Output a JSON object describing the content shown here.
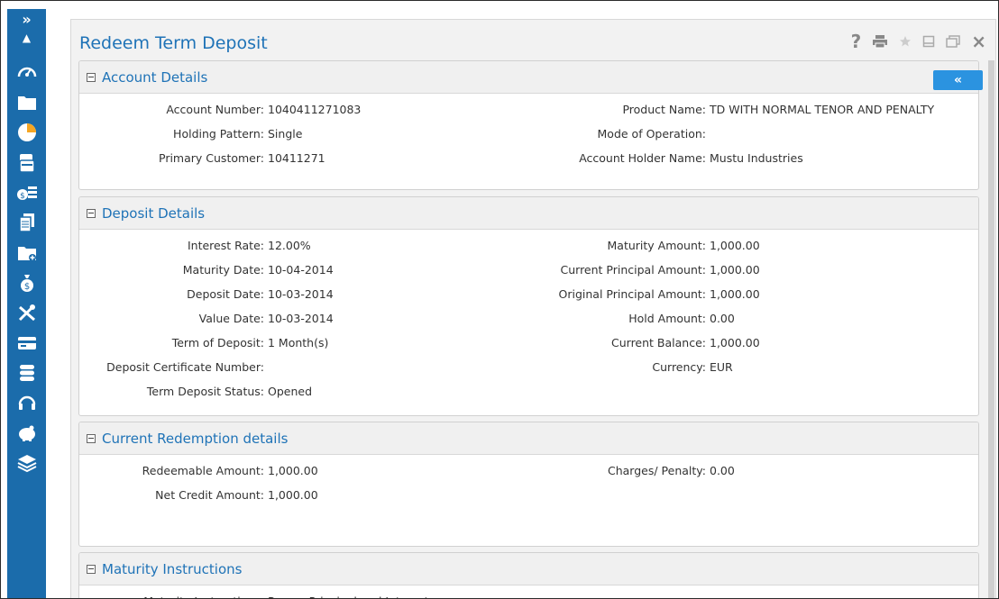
{
  "window": {
    "title": "Redeem Term Deposit",
    "collapse_label": "«"
  },
  "rail": {
    "expand_label": "»",
    "up_label": "▲",
    "icons": [
      "dashboard-icon",
      "folder-icon",
      "pie-chart-icon",
      "cards-icon",
      "money-icon",
      "documents-icon",
      "folder-add-icon",
      "money-bag-icon",
      "tools-icon",
      "credit-card-icon",
      "database-icon",
      "headset-icon",
      "piggy-bank-icon",
      "layers-icon"
    ]
  },
  "toolbar": {
    "help": "?",
    "print": "print-icon",
    "favorite": "star-icon",
    "minimize": "minimize-icon",
    "restore": "restore-icon",
    "close": "×"
  },
  "account": {
    "title": "Account Details",
    "left": [
      {
        "label": "Account Number:",
        "value": "1040411271083"
      },
      {
        "label": "Holding Pattern:",
        "value": "Single"
      },
      {
        "label": "Primary Customer:",
        "value": "10411271"
      }
    ],
    "right": [
      {
        "label": "Product Name:",
        "value": "TD WITH NORMAL TENOR AND PENALTY"
      },
      {
        "label": "Mode of Operation:",
        "value": ""
      },
      {
        "label": "Account Holder Name:",
        "value": "Mustu Industries"
      }
    ]
  },
  "deposit": {
    "title": "Deposit Details",
    "left": [
      {
        "label": "Interest Rate:",
        "value": "12.00%"
      },
      {
        "label": "Maturity Date:",
        "value": "10-04-2014"
      },
      {
        "label": "Deposit Date:",
        "value": "10-03-2014"
      },
      {
        "label": "Value Date:",
        "value": "10-03-2014"
      },
      {
        "label": "Term of Deposit:",
        "value": "1 Month(s)"
      },
      {
        "label": "Deposit Certificate Number:",
        "value": ""
      },
      {
        "label": "Term Deposit Status:",
        "value": "Opened"
      }
    ],
    "right": [
      {
        "label": "Maturity Amount:",
        "value": "1,000.00"
      },
      {
        "label": "Current Principal Amount:",
        "value": "1,000.00"
      },
      {
        "label": "Original Principal Amount:",
        "value": "1,000.00"
      },
      {
        "label": "Hold Amount:",
        "value": "0.00"
      },
      {
        "label": "Current Balance:",
        "value": "1,000.00"
      },
      {
        "label": "Currency:",
        "value": "EUR"
      }
    ]
  },
  "redemption": {
    "title": "Current Redemption details",
    "left": [
      {
        "label": "Redeemable Amount:",
        "value": "1,000.00"
      },
      {
        "label": "Net Credit Amount:",
        "value": "1,000.00"
      }
    ],
    "right": [
      {
        "label": "Charges/ Penalty:",
        "value": "0.00"
      }
    ]
  },
  "maturity": {
    "title": "Maturity Instructions",
    "left": [
      {
        "label": "Maturity Instructions:",
        "value": "Renew Principal and Interest"
      }
    ]
  },
  "colors": {
    "rail": "#1b6cab",
    "accent": "#1f73b7",
    "collapse_button": "#2b93e0",
    "pie_slice": "#f5a623"
  }
}
